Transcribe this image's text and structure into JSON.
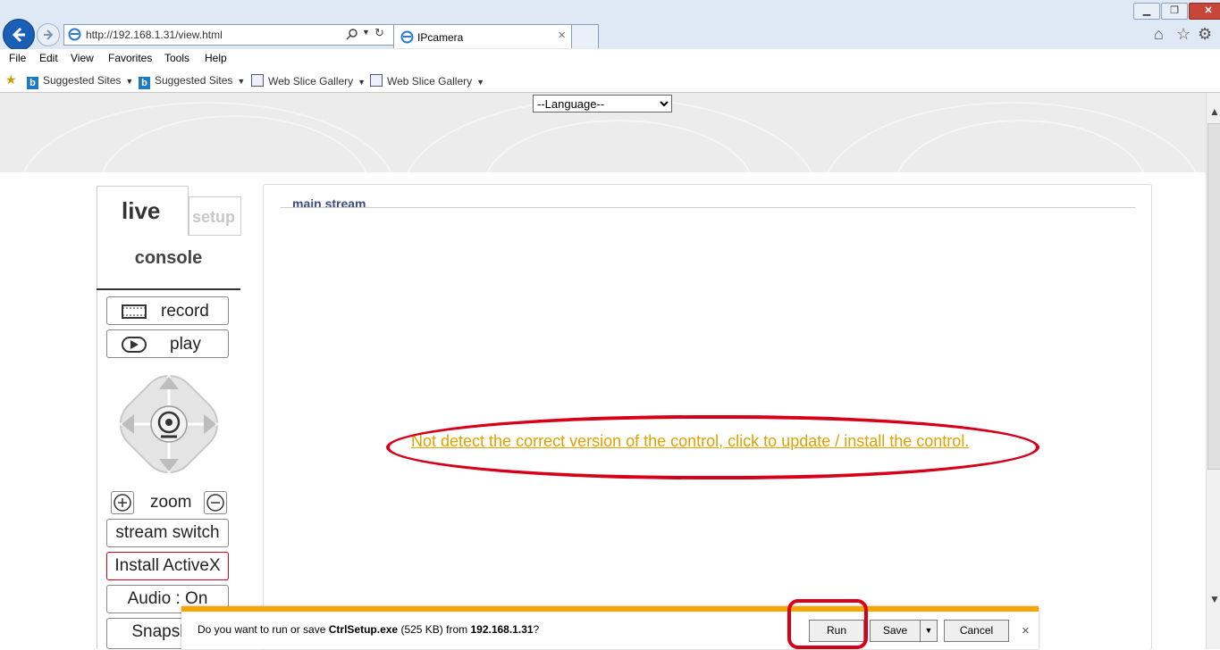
{
  "browser": {
    "url": "http://192.168.1.31/view.html",
    "tab_title": "IPcamera",
    "menu": [
      "File",
      "Edit",
      "View",
      "Favorites",
      "Tools",
      "Help"
    ],
    "favorites": [
      "Suggested Sites",
      "Suggested Sites",
      "Web Slice Gallery",
      "Web Slice Gallery"
    ]
  },
  "page": {
    "language_select": "--Language--",
    "tabs": {
      "live": "live",
      "setup": "setup"
    },
    "console_title": "console",
    "buttons": {
      "record": "record",
      "play": "play",
      "zoom": "zoom",
      "stream_switch": "stream switch",
      "install_activex": "Install ActiveX",
      "audio": "Audio : On",
      "snapshot": "Snapshot"
    },
    "main_stream_title": "main stream",
    "control_link": "Not detect the correct version of the control, click to update / install the control."
  },
  "download_bar": {
    "prefix": "Do you want to run or save ",
    "filename": "CtrlSetup.exe",
    "size": " (525 KB) from ",
    "host": "192.168.1.31",
    "suffix": "?",
    "run": "Run",
    "save": "Save",
    "cancel": "Cancel"
  },
  "colors": {
    "annotation": "#d60018",
    "link": "#e0a000",
    "download_accent": "#f7a600"
  }
}
